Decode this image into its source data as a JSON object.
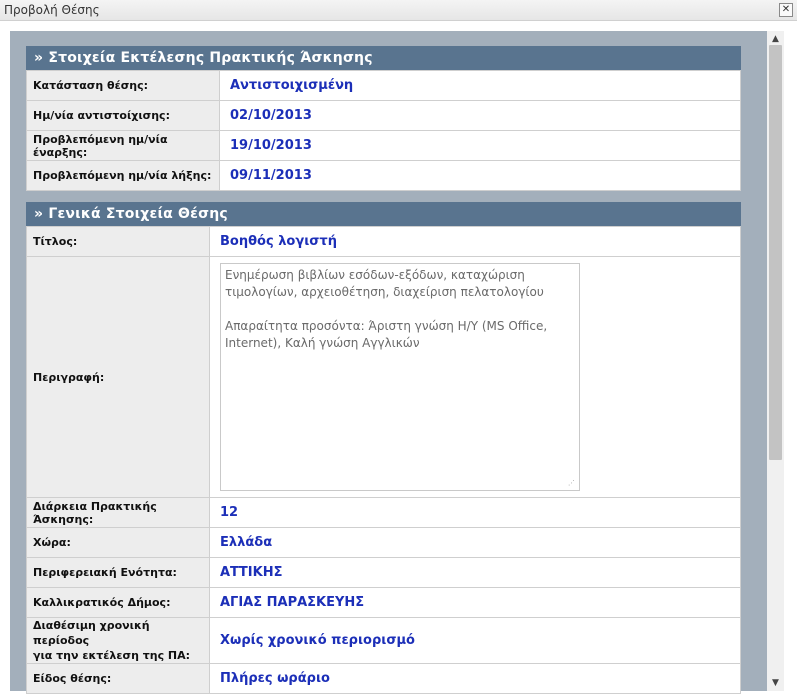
{
  "window": {
    "title": "Προβολή Θέσης"
  },
  "section1": {
    "header": "» Στοιχεία Εκτέλεσης Πρακτικής Άσκησης",
    "rows": [
      {
        "label": "Κατάσταση θέσης:",
        "value": "Αντιστοιχισμένη"
      },
      {
        "label": "Ημ/νία αντιστοίχισης:",
        "value": "02/10/2013"
      },
      {
        "label": "Προβλεπόμενη ημ/νία έναρξης:",
        "value": "19/10/2013"
      },
      {
        "label": "Προβλεπόμενη ημ/νία λήξης:",
        "value": "09/11/2013"
      }
    ]
  },
  "section2": {
    "header": "» Γενικά Στοιχεία Θέσης",
    "title_label": "Τίτλος:",
    "title_value": "Βοηθός λογιστή",
    "description_label": "Περιγραφή:",
    "description_p1": "Ενημέρωση βιβλίων εσόδων-εξόδων, καταχώριση τιμολογίων, αρχειοθέτηση, διαχείριση πελατολογίου",
    "description_p2": "Απαραίτητα προσόντα: Άριστη γνώση Η/Υ (MS Office, Internet), Καλή γνώση Αγγλικών",
    "rows": [
      {
        "label": "Διάρκεια Πρακτικής Άσκησης:",
        "value": "12"
      },
      {
        "label": "Χώρα:",
        "value": "Ελλάδα"
      },
      {
        "label": "Περιφερειακή Ενότητα:",
        "value": "ΑΤΤΙΚΗΣ"
      },
      {
        "label": "Καλλικρατικός Δήμος:",
        "value": "ΑΓΙΑΣ ΠΑΡΑΣΚΕΥΗΣ"
      },
      {
        "label_line1": "Διαθέσιμη χρονική περίοδος",
        "label_line2": "για την εκτέλεση της ΠΑ:",
        "value": "Χωρίς χρονικό περιορισμό"
      },
      {
        "label": "Είδος θέσης:",
        "value": "Πλήρες ωράριο"
      }
    ]
  }
}
